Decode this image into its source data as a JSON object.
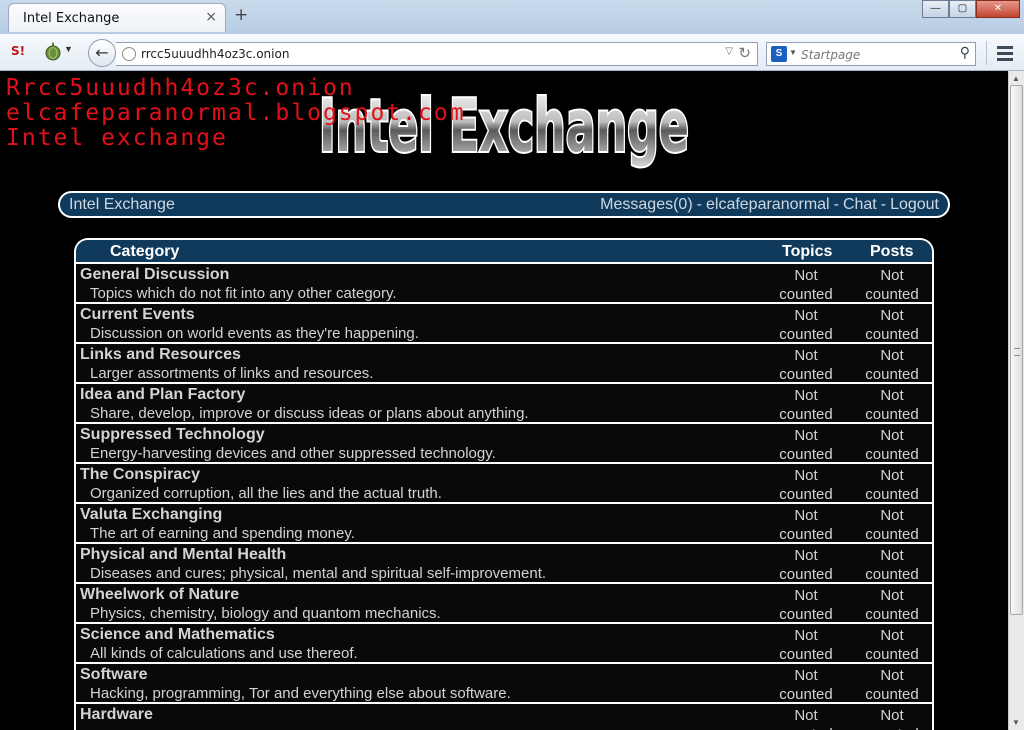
{
  "browser": {
    "tab_title": "Intel Exchange",
    "tab_close": "×",
    "new_tab": "+",
    "url": "rrcc5uuudhh4oz3c.onion",
    "search_placeholder": "Startpage",
    "s_icon": "S!",
    "win_min": "—",
    "win_max": "▢",
    "win_close": "✕",
    "icons": [
      "s-addon-icon",
      "onion-icon",
      "back-arrow-icon",
      "globe-icon",
      "reload-icon",
      "search-icon",
      "hamburger-menu-icon"
    ]
  },
  "watermark": {
    "line1": "Rrcc5uuudhh4oz3c.onion",
    "line2": "elcafeparanormal.blogspot.com",
    "line3": "Intel exchange",
    "color": "#e3101a"
  },
  "site": {
    "logo_text": "Intel Exchange",
    "title": "Intel Exchange",
    "links": [
      "Messages(0)",
      "elcafeparanormal",
      "Chat",
      "Logout"
    ],
    "link_separator": "-"
  },
  "forum": {
    "columns": [
      "Category",
      "Topics",
      "Posts"
    ],
    "categories": [
      {
        "name": "General Discussion",
        "desc": "Topics which do not fit into any other category.",
        "topics": "Not counted",
        "posts": "Not counted"
      },
      {
        "name": "Current Events",
        "desc": "Discussion on world events as they're happening.",
        "topics": "Not counted",
        "posts": "Not counted"
      },
      {
        "name": "Links and Resources",
        "desc": "Larger assortments of links and resources.",
        "topics": "Not counted",
        "posts": "Not counted"
      },
      {
        "name": "Idea and Plan Factory",
        "desc": "Share, develop, improve or discuss ideas or plans about anything.",
        "topics": "Not counted",
        "posts": "Not counted"
      },
      {
        "name": "Suppressed Technology",
        "desc": "Energy-harvesting devices and other suppressed technology.",
        "topics": "Not counted",
        "posts": "Not counted"
      },
      {
        "name": "The Conspiracy",
        "desc": "Organized corruption, all the lies and the actual truth.",
        "topics": "Not counted",
        "posts": "Not counted"
      },
      {
        "name": "Valuta Exchanging",
        "desc": "The art of earning and spending money.",
        "topics": "Not counted",
        "posts": "Not counted"
      },
      {
        "name": "Physical and Mental Health",
        "desc": "Diseases and cures; physical, mental and spiritual self-improvement.",
        "topics": "Not counted",
        "posts": "Not counted"
      },
      {
        "name": "Wheelwork of Nature",
        "desc": "Physics, chemistry, biology and quantom mechanics.",
        "topics": "Not counted",
        "posts": "Not counted"
      },
      {
        "name": "Science and Mathematics",
        "desc": "All kinds of calculations and use thereof.",
        "topics": "Not counted",
        "posts": "Not counted"
      },
      {
        "name": "Software",
        "desc": "Hacking, programming, Tor and everything else about software.",
        "topics": "Not counted",
        "posts": "Not counted"
      },
      {
        "name": "Hardware",
        "desc": "",
        "topics": "Not counted",
        "posts": "Not counted"
      }
    ]
  },
  "colors": {
    "header_bg": "#103a5c",
    "page_bg": "#000000",
    "text": "#d3d3d3"
  }
}
